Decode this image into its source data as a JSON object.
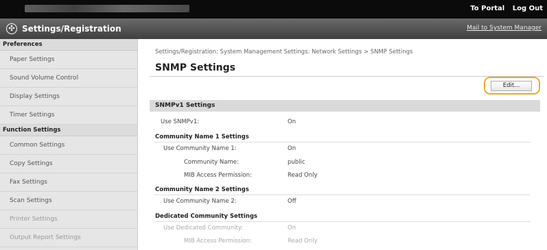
{
  "topbar": {
    "portal": "To Portal",
    "logout": "Log Out"
  },
  "header": {
    "title": "Settings/Registration",
    "mail": "Mail to System Manager"
  },
  "sidebar": {
    "preferences": "Preferences",
    "pref_items": [
      "Paper Settings",
      "Sound Volume Control",
      "Display Settings",
      "Timer Settings"
    ],
    "function": "Function Settings",
    "func_items": [
      "Common Settings",
      "Copy Settings",
      "Fax Settings",
      "Scan Settings",
      "Printer Settings",
      "Output Report Settings"
    ]
  },
  "main": {
    "breadcrumb": "Settings/Registration: System Management Settings: Network Settings > SNMP Settings",
    "title": "SNMP Settings",
    "edit": "Edit...",
    "section": "SNMPv1 Settings",
    "use_snmpv1": {
      "label": "Use SNMPv1:",
      "value": "On"
    },
    "comm1": "Community Name 1 Settings",
    "use_comm1": {
      "label": "Use Community Name 1:",
      "value": "On"
    },
    "comm_name": {
      "label": "Community Name:",
      "value": "public"
    },
    "mib1": {
      "label": "MIB Access Permission:",
      "value": "Read Only"
    },
    "comm2": "Community Name 2 Settings",
    "use_comm2": {
      "label": "Use Community Name 2:",
      "value": "Off"
    },
    "dedicated": "Dedicated Community Settings",
    "use_dedicated": {
      "label": "Use Dedicated Community:",
      "value": "On"
    },
    "mib2": {
      "label": "MIB Access Permission:",
      "value": "Read Only"
    }
  }
}
